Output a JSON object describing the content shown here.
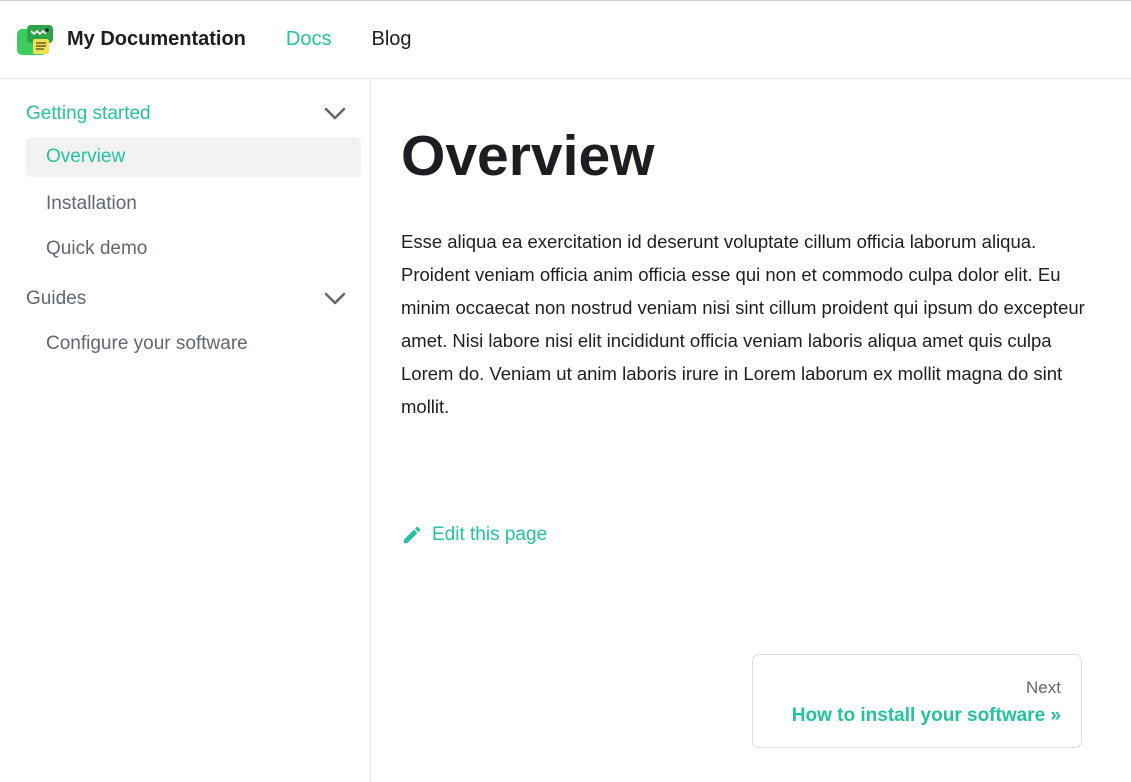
{
  "navbar": {
    "title": "My Documentation",
    "links": [
      {
        "label": "Docs",
        "active": true
      },
      {
        "label": "Blog",
        "active": false
      }
    ],
    "logo_icon": "dinosaur-logo-icon"
  },
  "sidebar": {
    "categories": [
      {
        "label": "Getting started",
        "expanded": true,
        "items": [
          {
            "label": "Overview",
            "active": true
          },
          {
            "label": "Installation",
            "active": false
          },
          {
            "label": "Quick demo",
            "active": false
          }
        ]
      },
      {
        "label": "Guides",
        "expanded": true,
        "items": [
          {
            "label": "Configure your software",
            "active": false
          }
        ]
      }
    ]
  },
  "main": {
    "title": "Overview",
    "paragraph": "Esse aliqua ea exercitation id deserunt voluptate cillum officia laborum aliqua. Proident veniam officia anim officia esse qui non et commodo culpa dolor elit. Eu minim occaecat non nostrud veniam nisi sint cillum proident qui ipsum do excepteur amet. Nisi labore nisi elit incididunt officia veniam laboris aliqua amet quis culpa Lorem do. Veniam ut anim laboris irure in Lorem laborum ex mollit magna do sint mollit.",
    "edit_label": "Edit this page",
    "edit_icon": "pencil-icon"
  },
  "pagination": {
    "next_sublabel": "Next",
    "next_label": "How to install your software »"
  },
  "colors": {
    "accent": "#25c2a0",
    "muted_text": "#606770",
    "text": "#1c1e21"
  }
}
